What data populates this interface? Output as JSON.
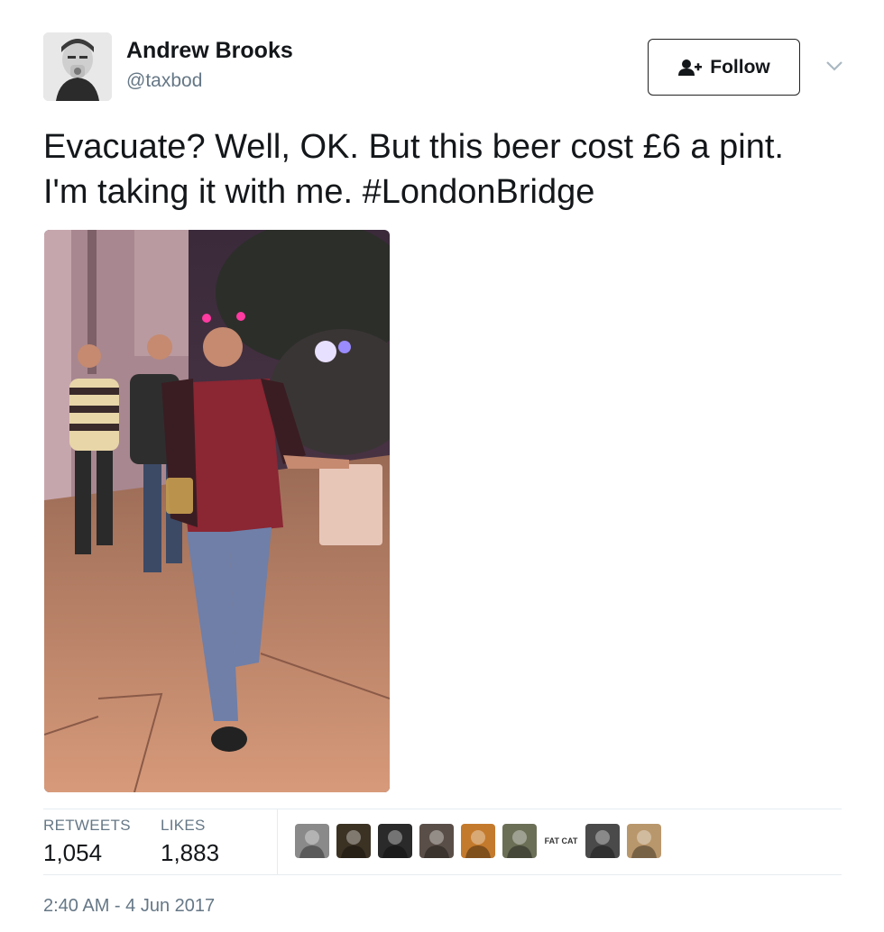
{
  "user": {
    "name": "Andrew Brooks",
    "handle": "@taxbod"
  },
  "follow": {
    "label": "Follow",
    "icon": "add-user-icon"
  },
  "menu": {
    "icon": "chevron-down-icon"
  },
  "tweet": {
    "text": "Evacuate? Well, OK. But this beer cost £6 a pint. I'm taking it with me. #LondonBridge"
  },
  "stats": {
    "retweets_label": "RETWEETS",
    "retweets_value": "1,054",
    "likes_label": "LIKES",
    "likes_value": "1,883"
  },
  "likers": [
    {
      "name": "liker-avatar-1",
      "color": "#8a8a8a"
    },
    {
      "name": "liker-avatar-2",
      "color": "#3b3224"
    },
    {
      "name": "liker-avatar-3",
      "color": "#2a2a2a"
    },
    {
      "name": "liker-avatar-4",
      "color": "#5a4f48"
    },
    {
      "name": "liker-avatar-5",
      "color": "#c47a2c"
    },
    {
      "name": "liker-avatar-6",
      "color": "#6b6f56"
    },
    {
      "name": "liker-avatar-7",
      "color": "#ffffff",
      "text": "FAT CAT"
    },
    {
      "name": "liker-avatar-8",
      "color": "#4a4a4a"
    },
    {
      "name": "liker-avatar-9",
      "color": "#b9976c"
    }
  ],
  "timestamp": "2:40 AM - 4 Jun 2017",
  "colors": {
    "text_primary": "#14171a",
    "text_secondary": "#657786",
    "divider": "#e6ecf0"
  }
}
